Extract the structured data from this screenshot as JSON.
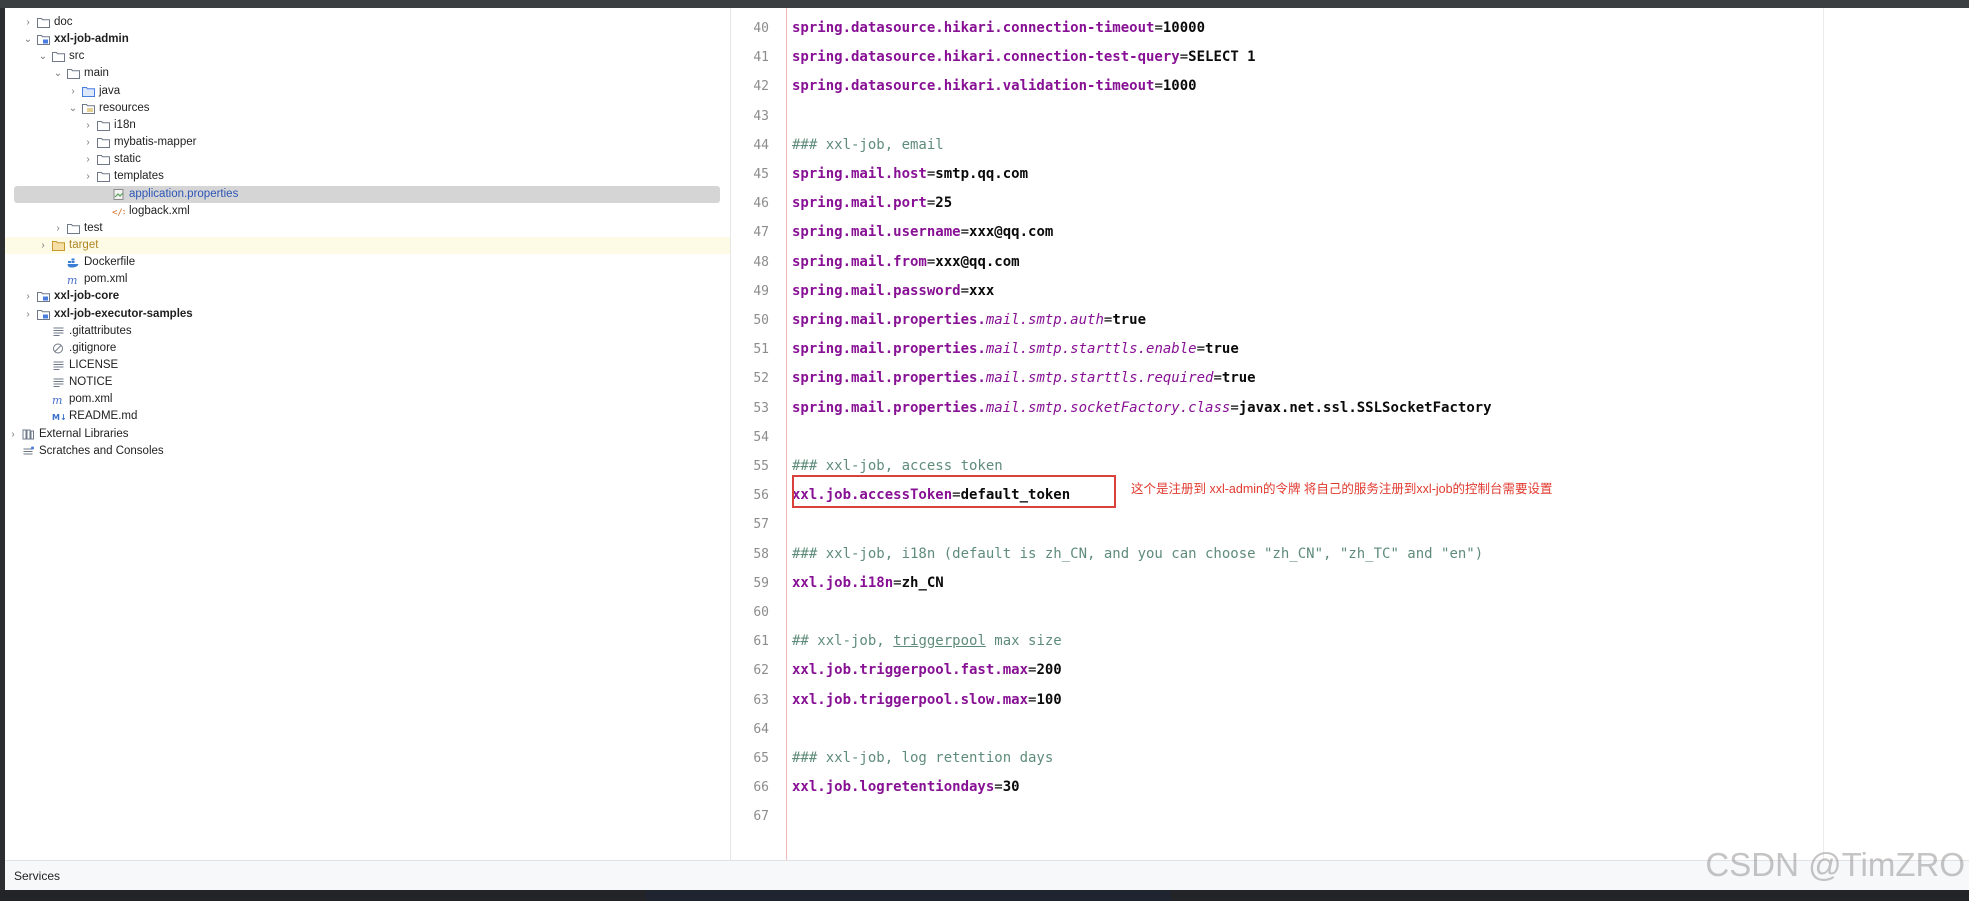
{
  "project_tree": [
    {
      "label": "doc",
      "indent": 0,
      "icon": "folder",
      "chevron": "right",
      "bold": false
    },
    {
      "label": "xxl-job-admin",
      "indent": 0,
      "icon": "module-folder",
      "chevron": "down",
      "bold": true
    },
    {
      "label": "src",
      "indent": 1,
      "icon": "folder",
      "chevron": "down",
      "bold": false
    },
    {
      "label": "main",
      "indent": 2,
      "icon": "folder",
      "chevron": "down",
      "bold": false
    },
    {
      "label": "java",
      "indent": 3,
      "icon": "source-folder",
      "chevron": "right",
      "bold": false
    },
    {
      "label": "resources",
      "indent": 3,
      "icon": "resources-folder",
      "chevron": "down",
      "bold": false
    },
    {
      "label": "i18n",
      "indent": 4,
      "icon": "folder",
      "chevron": "right",
      "bold": false
    },
    {
      "label": "mybatis-mapper",
      "indent": 4,
      "icon": "folder",
      "chevron": "right",
      "bold": false
    },
    {
      "label": "static",
      "indent": 4,
      "icon": "folder",
      "chevron": "right",
      "bold": false
    },
    {
      "label": "templates",
      "indent": 4,
      "icon": "folder",
      "chevron": "right",
      "bold": false
    },
    {
      "label": "application.properties",
      "indent": 5,
      "icon": "properties-file",
      "chevron": "none",
      "bold": false,
      "selected": true
    },
    {
      "label": "logback.xml",
      "indent": 5,
      "icon": "xml-file",
      "chevron": "none",
      "bold": false
    },
    {
      "label": "test",
      "indent": 2,
      "icon": "folder",
      "chevron": "right",
      "bold": false
    },
    {
      "label": "target",
      "indent": 1,
      "icon": "excluded-folder",
      "chevron": "right",
      "bold": false,
      "excluded": true
    },
    {
      "label": "Dockerfile",
      "indent": 2,
      "icon": "docker-file",
      "chevron": "none",
      "bold": false
    },
    {
      "label": "pom.xml",
      "indent": 2,
      "icon": "maven-file",
      "chevron": "none",
      "bold": false
    },
    {
      "label": "xxl-job-core",
      "indent": 0,
      "icon": "module-folder",
      "chevron": "right",
      "bold": true
    },
    {
      "label": "xxl-job-executor-samples",
      "indent": 0,
      "icon": "module-folder",
      "chevron": "right",
      "bold": true
    },
    {
      "label": ".gitattributes",
      "indent": 1,
      "icon": "text-file",
      "chevron": "none",
      "bold": false
    },
    {
      "label": ".gitignore",
      "indent": 1,
      "icon": "ignore-file",
      "chevron": "none",
      "bold": false
    },
    {
      "label": "LICENSE",
      "indent": 1,
      "icon": "text-file",
      "chevron": "none",
      "bold": false
    },
    {
      "label": "NOTICE",
      "indent": 1,
      "icon": "text-file",
      "chevron": "none",
      "bold": false
    },
    {
      "label": "pom.xml",
      "indent": 1,
      "icon": "maven-file",
      "chevron": "none",
      "bold": false
    },
    {
      "label": "README.md",
      "indent": 1,
      "icon": "markdown-file",
      "chevron": "none",
      "bold": false
    },
    {
      "label": "External Libraries",
      "indent": -1,
      "icon": "library",
      "chevron": "right",
      "bold": false
    },
    {
      "label": "Scratches and Consoles",
      "indent": -1,
      "icon": "scratches",
      "chevron": "none",
      "bold": false
    }
  ],
  "editor_lines": [
    {
      "n": "40",
      "parts": [
        [
          "k",
          "spring.datasource.hikari.connection-timeout"
        ],
        [
          "eq",
          "="
        ],
        [
          "v",
          "10000"
        ]
      ]
    },
    {
      "n": "41",
      "parts": [
        [
          "k",
          "spring.datasource.hikari.connection-test-query"
        ],
        [
          "eq",
          "="
        ],
        [
          "v",
          "SELECT 1"
        ]
      ]
    },
    {
      "n": "42",
      "parts": [
        [
          "k",
          "spring.datasource.hikari.validation-timeout"
        ],
        [
          "eq",
          "="
        ],
        [
          "v",
          "1000"
        ]
      ]
    },
    {
      "n": "43",
      "parts": []
    },
    {
      "n": "44",
      "parts": [
        [
          "c",
          "### xxl-job, email"
        ]
      ]
    },
    {
      "n": "45",
      "parts": [
        [
          "k",
          "spring.mail.host"
        ],
        [
          "eq",
          "="
        ],
        [
          "v",
          "smtp.qq.com"
        ]
      ]
    },
    {
      "n": "46",
      "parts": [
        [
          "k",
          "spring.mail.port"
        ],
        [
          "eq",
          "="
        ],
        [
          "v",
          "25"
        ]
      ]
    },
    {
      "n": "47",
      "parts": [
        [
          "k",
          "spring.mail.username"
        ],
        [
          "eq",
          "="
        ],
        [
          "v",
          "xxx@qq.com"
        ]
      ]
    },
    {
      "n": "48",
      "parts": [
        [
          "k",
          "spring.mail.from"
        ],
        [
          "eq",
          "="
        ],
        [
          "v",
          "xxx@qq.com"
        ]
      ]
    },
    {
      "n": "49",
      "parts": [
        [
          "k",
          "spring.mail.password"
        ],
        [
          "eq",
          "="
        ],
        [
          "v",
          "xxx"
        ]
      ]
    },
    {
      "n": "50",
      "parts": [
        [
          "k",
          "spring.mail.properties."
        ],
        [
          "ki",
          "mail.smtp.auth"
        ],
        [
          "eq",
          "="
        ],
        [
          "v",
          "true"
        ]
      ]
    },
    {
      "n": "51",
      "parts": [
        [
          "k",
          "spring.mail.properties."
        ],
        [
          "ki",
          "mail.smtp.starttls.enable"
        ],
        [
          "eq",
          "="
        ],
        [
          "v",
          "true"
        ]
      ]
    },
    {
      "n": "52",
      "parts": [
        [
          "k",
          "spring.mail.properties."
        ],
        [
          "ki",
          "mail.smtp.starttls.required"
        ],
        [
          "eq",
          "="
        ],
        [
          "v",
          "true"
        ]
      ]
    },
    {
      "n": "53",
      "parts": [
        [
          "k",
          "spring.mail.properties."
        ],
        [
          "ki",
          "mail.smtp.socketFactory.class"
        ],
        [
          "eq",
          "="
        ],
        [
          "v",
          "javax.net.ssl.SSLSocketFactory"
        ]
      ]
    },
    {
      "n": "54",
      "parts": []
    },
    {
      "n": "55",
      "parts": [
        [
          "c",
          "### xxl-job, access token"
        ]
      ]
    },
    {
      "n": "56",
      "parts": [
        [
          "k",
          "xxl.job.accessToken"
        ],
        [
          "eq",
          "="
        ],
        [
          "v",
          "default_token"
        ]
      ]
    },
    {
      "n": "57",
      "parts": []
    },
    {
      "n": "58",
      "parts": [
        [
          "c",
          "### xxl-job, i18n (default is zh_CN, and you can choose \"zh_CN\", \"zh_TC\" and \"en\")"
        ]
      ]
    },
    {
      "n": "59",
      "parts": [
        [
          "k",
          "xxl.job.i18n"
        ],
        [
          "eq",
          "="
        ],
        [
          "v",
          "zh_CN"
        ]
      ]
    },
    {
      "n": "60",
      "parts": []
    },
    {
      "n": "61",
      "parts": [
        [
          "c",
          "## xxl-job, "
        ],
        [
          "cu",
          "triggerpool"
        ],
        [
          "c",
          " max size"
        ]
      ]
    },
    {
      "n": "62",
      "parts": [
        [
          "k",
          "xxl.job.triggerpool.fast.max"
        ],
        [
          "eq",
          "="
        ],
        [
          "v",
          "200"
        ]
      ]
    },
    {
      "n": "63",
      "parts": [
        [
          "k",
          "xxl.job.triggerpool.slow.max"
        ],
        [
          "eq",
          "="
        ],
        [
          "v",
          "100"
        ]
      ]
    },
    {
      "n": "64",
      "parts": []
    },
    {
      "n": "65",
      "parts": [
        [
          "c",
          "### xxl-job, log retention days"
        ]
      ]
    },
    {
      "n": "66",
      "parts": [
        [
          "k",
          "xxl.job.logretentiondays"
        ],
        [
          "eq",
          "="
        ],
        [
          "v",
          "30"
        ]
      ]
    },
    {
      "n": "67",
      "parts": []
    }
  ],
  "annotation": {
    "text": "这个是注册到 xxl-admin的令牌  将自己的服务注册到xxl-job的控制台需要设置"
  },
  "statusbar": {
    "services_label": "Services"
  },
  "watermark": {
    "text": "CSDN @TimZRO"
  }
}
